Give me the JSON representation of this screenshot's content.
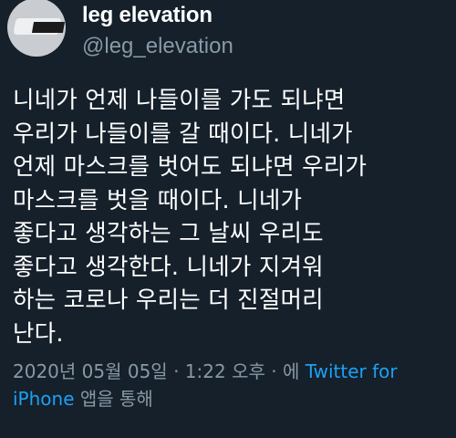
{
  "profile": {
    "display_name": "leg elevation",
    "handle": "@leg_elevation",
    "avatar": "avatar-photo"
  },
  "tweet": {
    "lines": [
      "니네가 언제 나들이를 가도 되냐면",
      "우리가 나들이를 갈 때이다. 니네가",
      "언제 마스크를 벗어도 되냐면 우리가",
      "마스크를 벗을 때이다. 니네가",
      "좋다고 생각하는 그 날씨 우리도",
      "좋다고 생각한다. 니네가 지겨워",
      "하는 코로나 우리는 더 진절머리",
      "난다."
    ],
    "date": "2020년 05월 05일",
    "separator1": " · ",
    "time": "1:22 오후",
    "separator2": " · ",
    "via": "에 ",
    "source": "Twitter for",
    "source2": "iPhone",
    "suffix": " 앱을 통해"
  },
  "colors": {
    "background": "#15202b",
    "text": "#ffffff",
    "secondary": "#8899a6",
    "link": "#1da1f2"
  }
}
